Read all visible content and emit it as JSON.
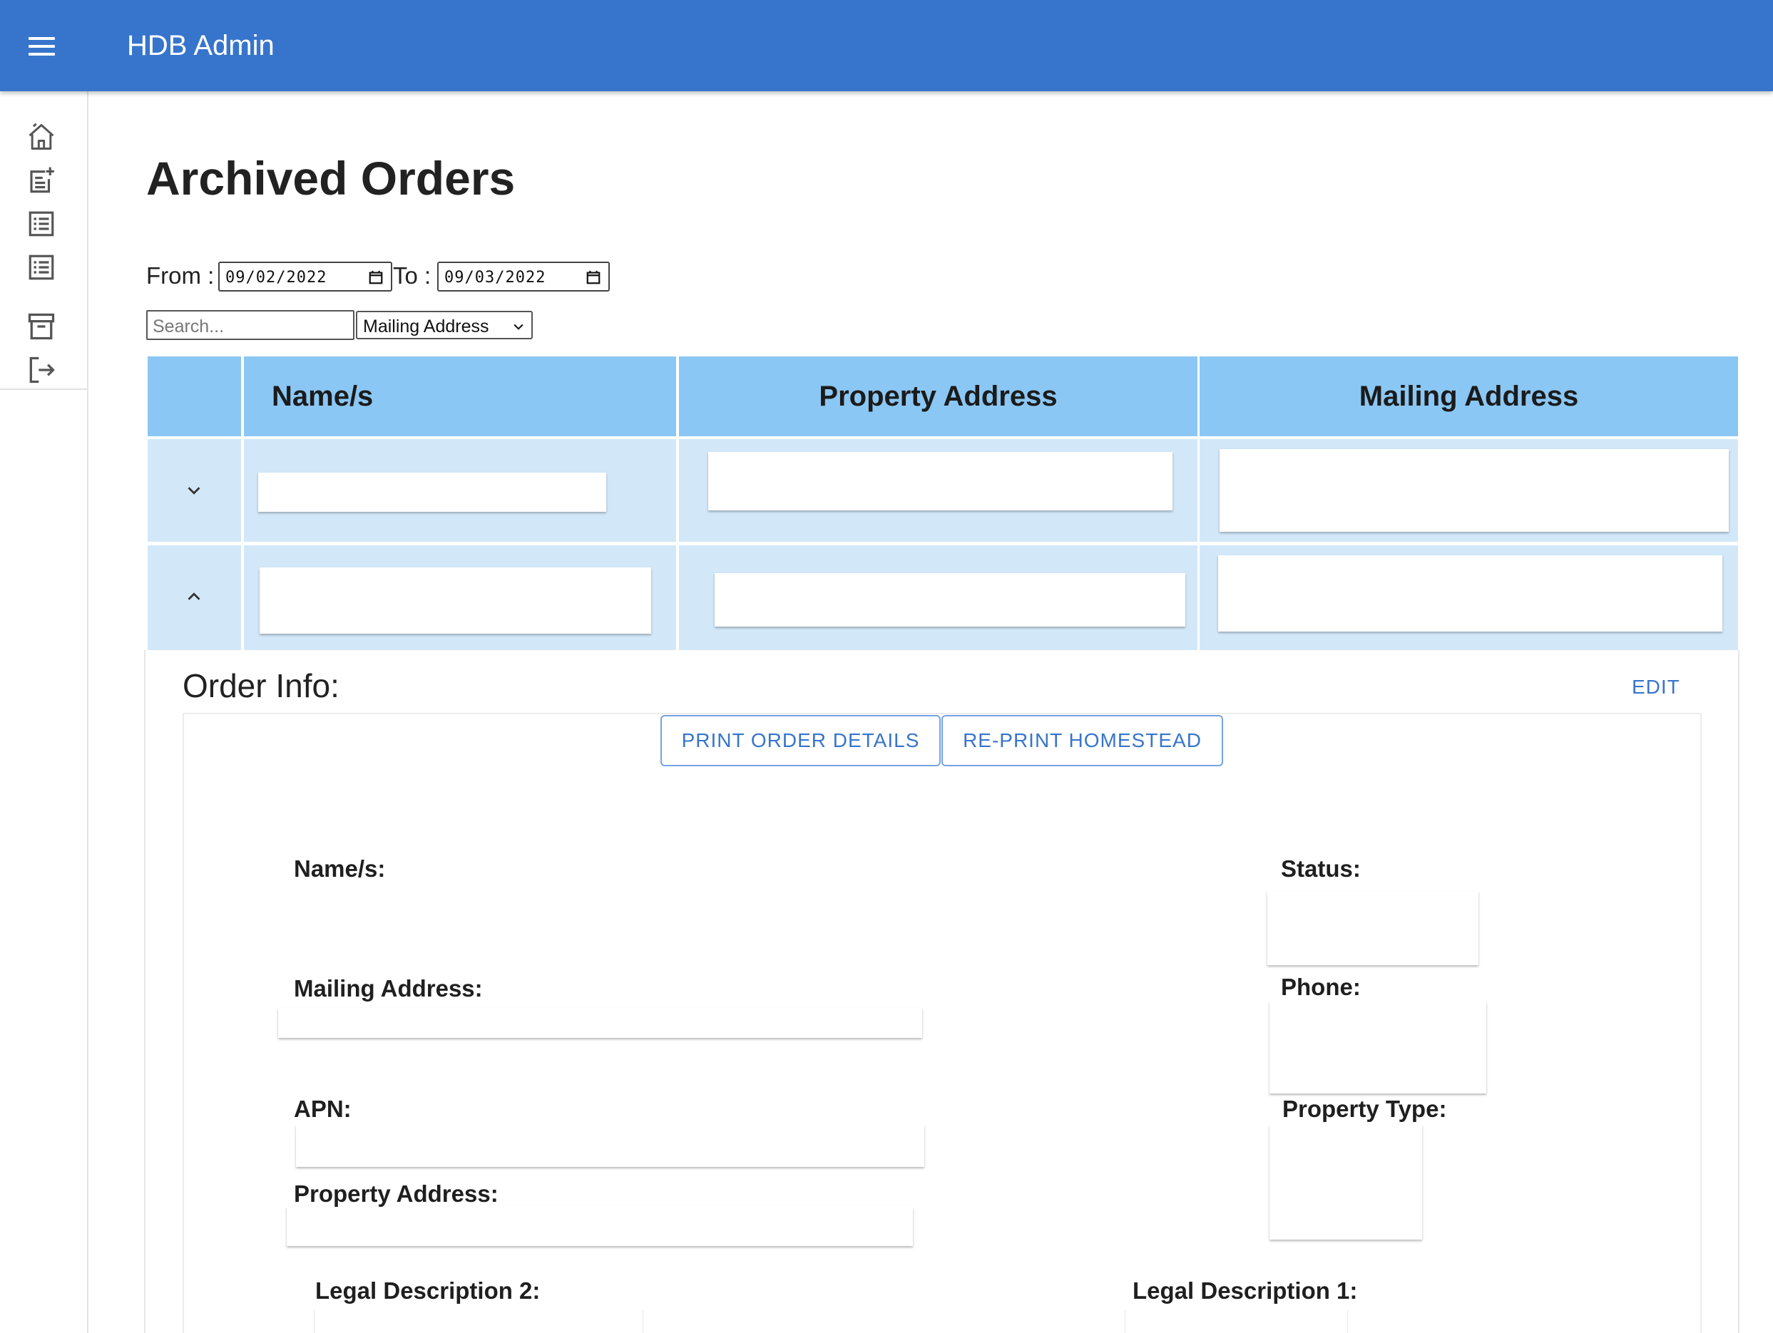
{
  "app": {
    "title": "HDB Admin"
  },
  "sidebar": {
    "items": [
      {
        "icon": "home-icon"
      },
      {
        "icon": "new-order-icon"
      },
      {
        "icon": "order-list-icon"
      },
      {
        "icon": "list-icon"
      },
      {
        "icon": "archive-icon"
      },
      {
        "icon": "logout-icon"
      }
    ]
  },
  "page": {
    "title": "Archived Orders"
  },
  "filters": {
    "from_label": "From :",
    "from_date": "09/02/2022",
    "to_label": "To :",
    "to_date": "09/03/2022",
    "search_placeholder": "Search...",
    "search_field": "Mailing Address"
  },
  "table": {
    "headers": [
      "Name/s",
      "Property Address",
      "Mailing Address"
    ],
    "rows": [
      {
        "expanded": false,
        "name": "",
        "property_address": "",
        "mailing_address": ""
      },
      {
        "expanded": true,
        "name": "",
        "property_address": "",
        "mailing_address": ""
      }
    ]
  },
  "order_info": {
    "title": "Order Info:",
    "edit_label": "EDIT",
    "print_details_label": "PRINT ORDER DETAILS",
    "reprint_label": "RE-PRINT HOMESTEAD",
    "fields": {
      "names_label": "Name/s:",
      "status_label": "Status:",
      "mailing_address_label": "Mailing Address:",
      "phone_label": "Phone:",
      "apn_label": "APN:",
      "property_type_label": "Property Type:",
      "property_address_label": "Property Address:",
      "legal_desc2_label": "Legal Description 2:",
      "legal_desc1_label": "Legal Description 1:"
    }
  },
  "colors": {
    "appbar": "#3775cc",
    "table_header": "#8bc7f4",
    "table_row": "#d2e8f9",
    "link": "#3775cc"
  }
}
